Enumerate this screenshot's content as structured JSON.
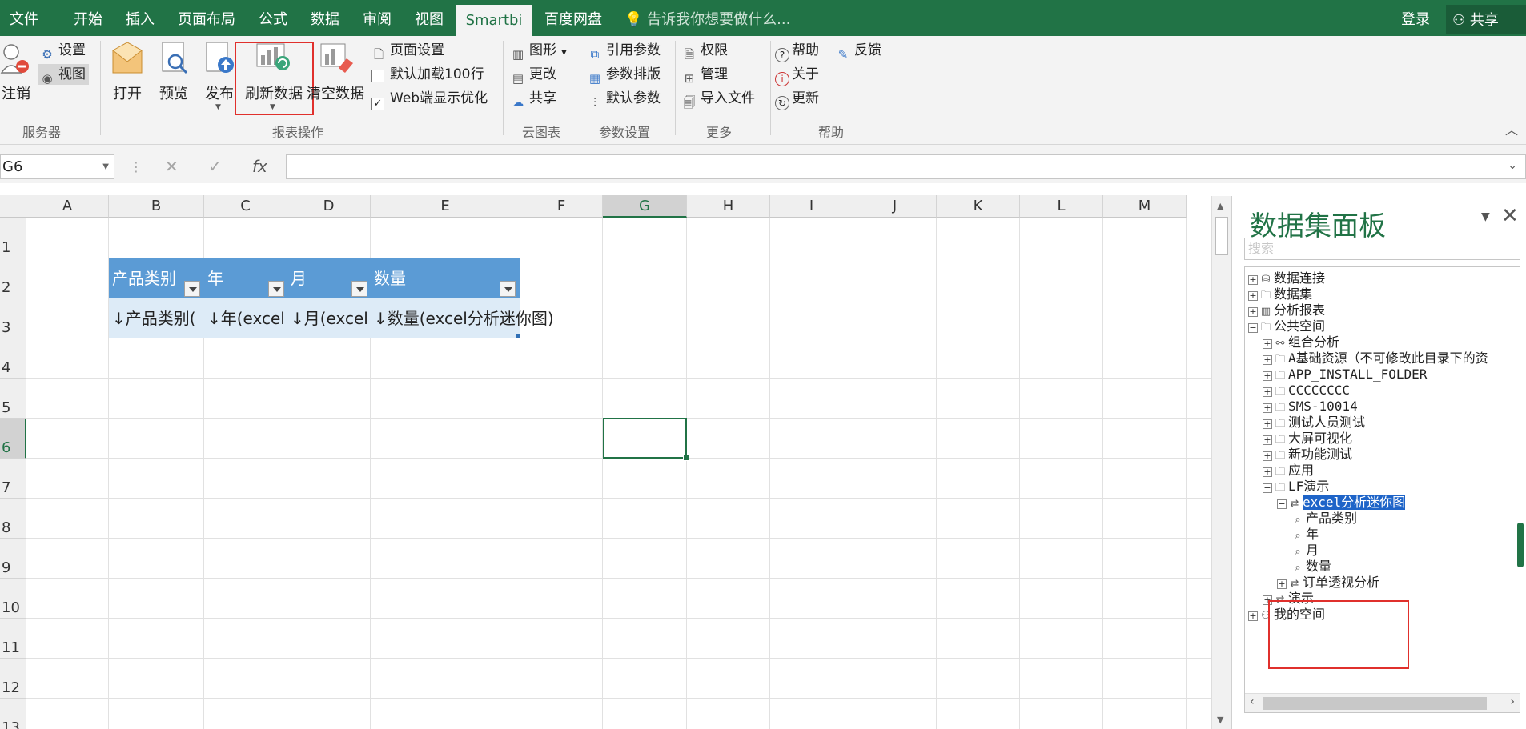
{
  "tabs": [
    {
      "label": "文件"
    },
    {
      "label": "开始"
    },
    {
      "label": "插入"
    },
    {
      "label": "页面布局"
    },
    {
      "label": "公式"
    },
    {
      "label": "数据"
    },
    {
      "label": "审阅"
    },
    {
      "label": "视图"
    },
    {
      "label": "Smartbi"
    },
    {
      "label": "百度网盘"
    }
  ],
  "tell_me": "告诉我你想要做什么...",
  "login": "登录",
  "share": "共享",
  "ribbon": {
    "server": {
      "logout": "注销",
      "settings": "设置",
      "view": "视图",
      "group": "服务器"
    },
    "report": {
      "open": "打开",
      "preview": "预览",
      "publish": "发布",
      "refresh": "刷新数据",
      "clear": "清空数据",
      "page_setup": "页面设置",
      "load100": "默认加载100行",
      "web_opt": "Web端显示优化",
      "group": "报表操作"
    },
    "cloud": {
      "chart": "图形",
      "change": "更改",
      "share": "共享",
      "group": "云图表"
    },
    "params": {
      "ref": "引用参数",
      "layout": "参数排版",
      "default": "默认参数",
      "group": "参数设置"
    },
    "more": {
      "perm": "权限",
      "manage": "管理",
      "import": "导入文件",
      "group": "更多"
    },
    "help": {
      "help": "帮助",
      "feedback": "反馈",
      "about": "关于",
      "update": "更新",
      "group": "帮助"
    }
  },
  "formula_bar": {
    "name_box": "G6",
    "formula": ""
  },
  "columns": [
    "A",
    "B",
    "C",
    "D",
    "E",
    "F",
    "G",
    "H",
    "I",
    "J",
    "K",
    "L",
    "M"
  ],
  "rows": [
    "1",
    "2",
    "3",
    "4",
    "5",
    "6",
    "7",
    "8",
    "9",
    "10",
    "11",
    "12",
    "13"
  ],
  "selected_cell": "G6",
  "table": {
    "headers": [
      "产品类别",
      "年",
      "月",
      "数量"
    ],
    "cells": [
      "↓产品类别(",
      "↓年(excel",
      "↓月(excel",
      "↓数量(excel分析迷你图)"
    ]
  },
  "panel": {
    "title": "数据集面板",
    "search_placeholder": "搜索",
    "tree": [
      {
        "label": "数据连接",
        "toggle": "+",
        "icon": "db"
      },
      {
        "label": "数据集",
        "toggle": "+",
        "icon": "folder"
      },
      {
        "label": "分析报表",
        "toggle": "+",
        "icon": "chart"
      },
      {
        "label": "公共空间",
        "toggle": "−",
        "icon": "folder"
      },
      {
        "label": "组合分析",
        "toggle": "+",
        "icon": "combo"
      },
      {
        "label": "A基础资源（不可修改此目录下的资",
        "toggle": "+",
        "icon": "folder"
      },
      {
        "label": "APP_INSTALL_FOLDER",
        "toggle": "+",
        "icon": "folder"
      },
      {
        "label": "CCCCCCCC",
        "toggle": "+",
        "icon": "folder"
      },
      {
        "label": "SMS-10014",
        "toggle": "+",
        "icon": "folder"
      },
      {
        "label": "测试人员测试",
        "toggle": "+",
        "icon": "folder"
      },
      {
        "label": "大屏可视化",
        "toggle": "+",
        "icon": "folder"
      },
      {
        "label": "新功能测试",
        "toggle": "+",
        "icon": "folder"
      },
      {
        "label": "应用",
        "toggle": "+",
        "icon": "folder"
      },
      {
        "label": "LF演示",
        "toggle": "−",
        "icon": "folder"
      },
      {
        "label": "excel分析迷你图",
        "toggle": "−",
        "icon": "report"
      },
      {
        "label": "产品类别",
        "toggle": "",
        "icon": "field"
      },
      {
        "label": "年",
        "toggle": "",
        "icon": "field"
      },
      {
        "label": "月",
        "toggle": "",
        "icon": "field"
      },
      {
        "label": "数量",
        "toggle": "",
        "icon": "field"
      },
      {
        "label": "订单透视分析",
        "toggle": "+",
        "icon": "report"
      },
      {
        "label": "演示",
        "toggle": "+",
        "icon": "report"
      },
      {
        "label": "我的空间",
        "toggle": "+",
        "icon": "user"
      }
    ]
  },
  "colors": {
    "excel_green": "#217346",
    "table_header": "#5b9bd5",
    "table_row": "#ddebf7",
    "highlight": "#e0302c",
    "tree_select": "#1e64c8"
  }
}
